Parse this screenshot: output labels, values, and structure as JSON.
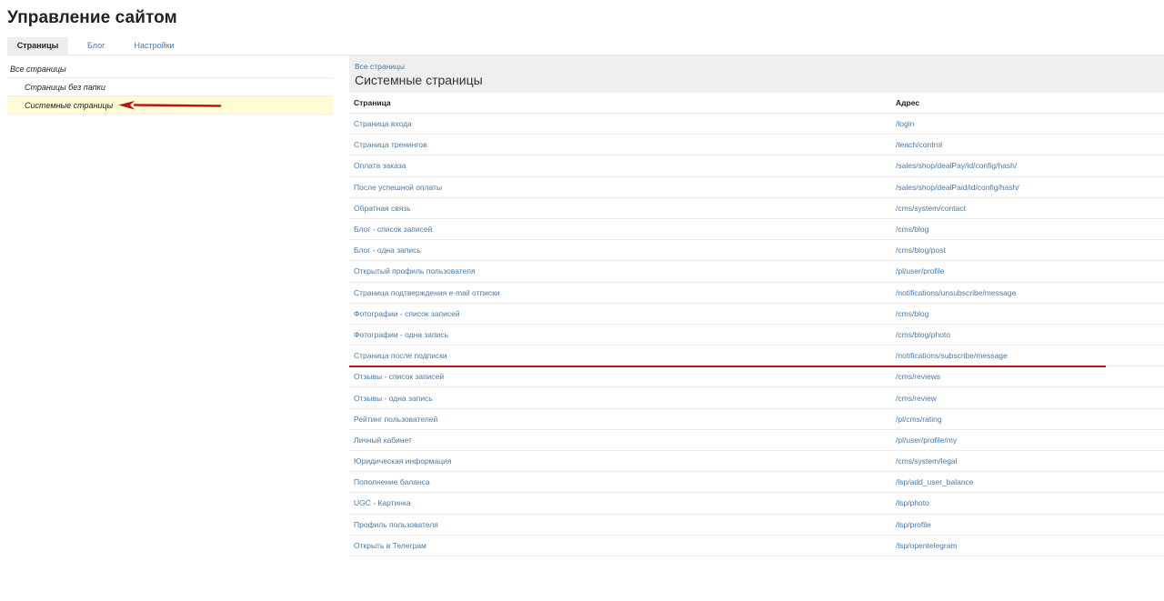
{
  "header": {
    "title": "Управление сайтом"
  },
  "tabs": [
    {
      "label": "Страницы"
    },
    {
      "label": "Блог"
    },
    {
      "label": "Настройки"
    }
  ],
  "sidebar": {
    "items": [
      {
        "label": "Все страницы"
      },
      {
        "label": "Страницы без папки"
      },
      {
        "label": "Системные страницы"
      }
    ]
  },
  "main": {
    "breadcrumb": "Все страницы",
    "title": "Системные страницы",
    "columns": {
      "page": "Страница",
      "address": "Адрес"
    },
    "rows": [
      {
        "page": "Страница входа",
        "address": "/login"
      },
      {
        "page": "Страница тренингов",
        "address": "/teach/control"
      },
      {
        "page": "Оплата заказа",
        "address": "/sales/shop/dealPay/id/config/hash/"
      },
      {
        "page": "После успешной оплаты",
        "address": "/sales/shop/dealPaid/id/config/hash/"
      },
      {
        "page": "Обратная связь",
        "address": "/cms/system/contact"
      },
      {
        "page": "Блог - список записей",
        "address": "/cms/blog"
      },
      {
        "page": "Блог - одна запись",
        "address": "/cms/blog/post"
      },
      {
        "page": "Открытый профиль пользователя",
        "address": "/pl/user/profile"
      },
      {
        "page": "Страница подтверждения e-mail отписки",
        "address": "/notifications/unsubscribe/message"
      },
      {
        "page": "Фотографии - список записей",
        "address": "/cms/blog"
      },
      {
        "page": "Фотографии - одна запись",
        "address": "/cms/blog/photo"
      },
      {
        "page": "Страница после подписки",
        "address": "/notifications/subscribe/message"
      },
      {
        "page": "Отзывы - список записей",
        "address": "/cms/reviews"
      },
      {
        "page": "Отзывы - одна запись",
        "address": "/cms/review"
      },
      {
        "page": "Рейтинг пользователей",
        "address": "/pl/cms/rating"
      },
      {
        "page": "Личный кабинет",
        "address": "/pl/user/profile/my"
      },
      {
        "page": "Юридическая информация",
        "address": "/cms/system/legal"
      },
      {
        "page": "Пополнение баланса",
        "address": "/lsp/add_user_balance"
      },
      {
        "page": "UGC - Картинка",
        "address": "/lsp/photo"
      },
      {
        "page": "Профиль пользователя",
        "address": "/lsp/profile"
      },
      {
        "page": "Открыть в Телеграм",
        "address": "/lsp/opentelegram"
      }
    ]
  },
  "colors": {
    "link": "#4a79a5",
    "highlight": "#fffbd4",
    "annotation": "#b01c1c"
  }
}
